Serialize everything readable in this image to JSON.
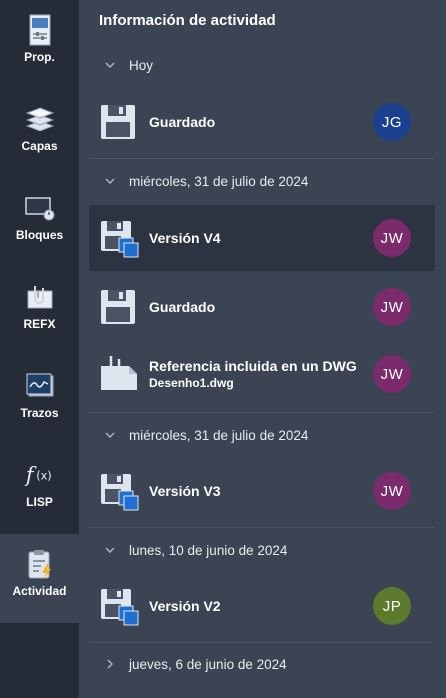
{
  "sidebar": {
    "items": [
      {
        "label": "Prop.",
        "icon": "properties-icon"
      },
      {
        "label": "Capas",
        "icon": "layers-icon"
      },
      {
        "label": "Bloques",
        "icon": "blocks-icon"
      },
      {
        "label": "REFX",
        "icon": "xref-icon"
      },
      {
        "label": "Trazos",
        "icon": "traces-icon"
      },
      {
        "label": "LISP",
        "icon": "lisp-function-icon"
      },
      {
        "label": "Actividad",
        "icon": "activity-clipboard-icon"
      }
    ],
    "active_index": 6
  },
  "panel": {
    "title": "Información de actividad",
    "groups": [
      {
        "label": "Hoy",
        "expanded": true
      },
      {
        "label": "miércoles, 31 de julio de 2024",
        "expanded": true
      },
      {
        "label": "miércoles, 31 de julio de 2024",
        "expanded": true
      },
      {
        "label": "lunes, 10 de junio de 2024",
        "expanded": true
      },
      {
        "label": "jueves, 6 de junio de 2024",
        "expanded": false
      }
    ],
    "rows": [
      {
        "title": "Guardado",
        "subtitle": "",
        "icon": "save-icon",
        "initials": "JG",
        "avatar_color": "#1c3f8f"
      },
      {
        "title": "Versión V4",
        "subtitle": "",
        "icon": "version-save-icon",
        "initials": "JW",
        "avatar_color": "#7b2a6b"
      },
      {
        "title": "Guardado",
        "subtitle": "",
        "icon": "save-icon",
        "initials": "JW",
        "avatar_color": "#7b2a6b"
      },
      {
        "title": "Referencia incluida en un DWG",
        "subtitle": "Desenho1.dwg",
        "icon": "document-reference-icon",
        "initials": "JW",
        "avatar_color": "#7b2a6b"
      },
      {
        "title": "Versión V3",
        "subtitle": "",
        "icon": "version-save-icon",
        "initials": "JW",
        "avatar_color": "#7b2a6b"
      },
      {
        "title": "Versión V2",
        "subtitle": "",
        "icon": "version-save-icon",
        "initials": "JP",
        "avatar_color": "#5b7a2e"
      }
    ]
  }
}
